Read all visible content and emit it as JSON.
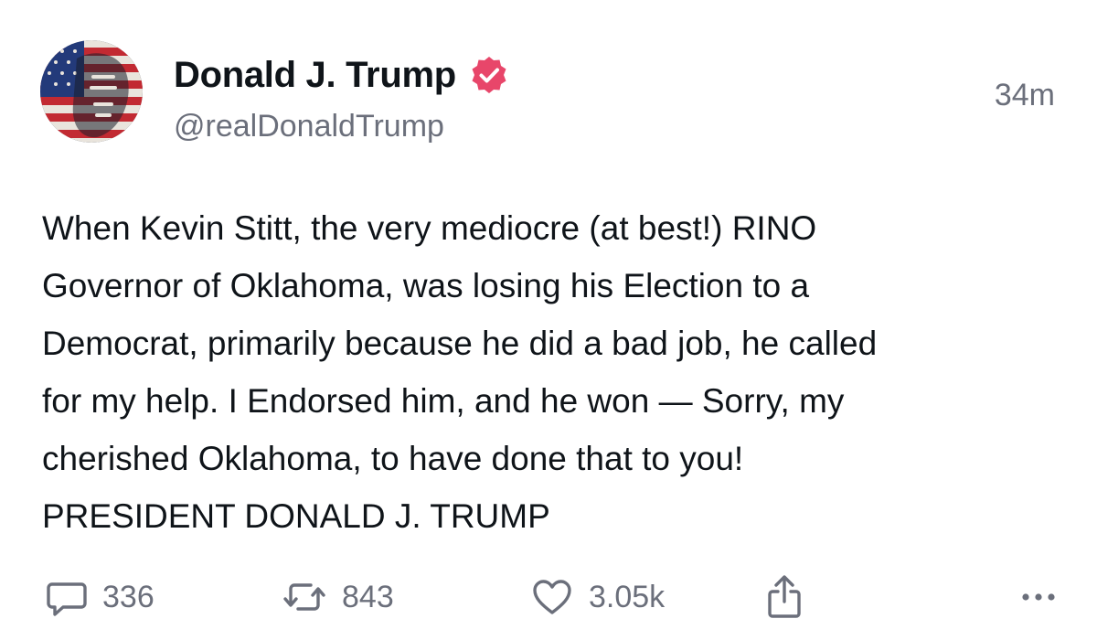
{
  "post": {
    "author": {
      "display_name": "Donald J. Trump",
      "handle": "@realDonaldTrump",
      "verified": true,
      "verified_color": "#e8466a",
      "avatar_icon": "flag-portrait-avatar"
    },
    "timestamp": "34m",
    "body": "When Kevin Stitt, the very mediocre (at best!) RINO\nGovernor of Oklahoma, was losing his Election to a\nDemocrat, primarily because he did a bad job, he called\nfor my help. I Endorsed him, and he won — Sorry, my\ncherished Oklahoma, to have done that to you!\nPRESIDENT DONALD J. TRUMP",
    "actions": {
      "reply": {
        "icon": "reply-icon",
        "count": "336"
      },
      "repost": {
        "icon": "repost-icon",
        "count": "843"
      },
      "like": {
        "icon": "heart-icon",
        "count": "3.05k"
      },
      "share": {
        "icon": "share-icon"
      },
      "more": {
        "icon": "more-icon"
      }
    }
  },
  "colors": {
    "text_primary": "#0f1419",
    "text_secondary": "#6b6f7b",
    "icon": "#6b6f7b",
    "background": "#ffffff"
  }
}
